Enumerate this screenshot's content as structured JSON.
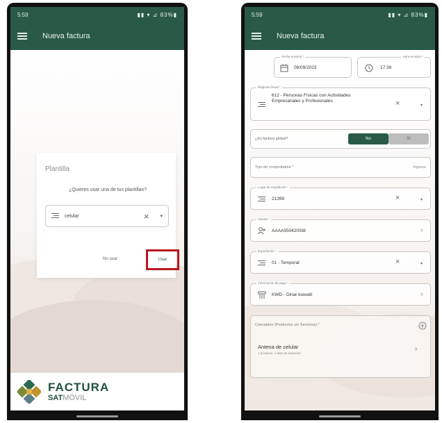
{
  "left_phone": {
    "status_time": "5:59",
    "status_right": "▮▮ ▾ ⊿ 83%▮",
    "app_title": "Nueva factura",
    "dialog": {
      "title": "Plantilla",
      "question": "¿Quieres usar una de tus plantillas?",
      "select_value": "celular",
      "cancel_label": "No usar",
      "use_label": "Usar"
    },
    "logo": {
      "line1": "FACTURA",
      "sat": "SAT",
      "movil": "MÓVIL"
    }
  },
  "right_phone": {
    "status_time": "5:59",
    "status_right": "▮▮ ▾ ⊿ 83%▮",
    "app_title": "Nueva factura",
    "fecha_label": "Fecha emisión *",
    "fecha_value": "06/09/2023",
    "hora_label": "Hora emisión *",
    "hora_value": "17:39",
    "regimen_label": "Régimen fiscal *",
    "regimen_value": "612 - Personas Físicas con Actividades Empresariales y Profesionales",
    "global_label": "¿Es factura global?",
    "global_no": "No",
    "global_si": "Sí",
    "tipo_label": "Tipo de comprobante *",
    "tipo_value": "Ingreso",
    "lugar_label": "Lugar de expedición *",
    "lugar_value": "21399",
    "cliente_label": "Cliente *",
    "cliente_value": "AAAA550420SI8",
    "exportacion_label": "Exportación *",
    "exportacion_value": "01 - Temporal",
    "metodo_label": "Información de pago *",
    "metodo_value": "KWD - Dinar kuwaití",
    "conceptos_label": "Conceptos (Productos y/o Servicios) *",
    "concepto_title": "Antena de celular",
    "concepto_sub": "1 producto, 1 tasa de impuesto"
  },
  "colors": {
    "primary": "#2a5a47",
    "highlight": "#b9151d"
  }
}
